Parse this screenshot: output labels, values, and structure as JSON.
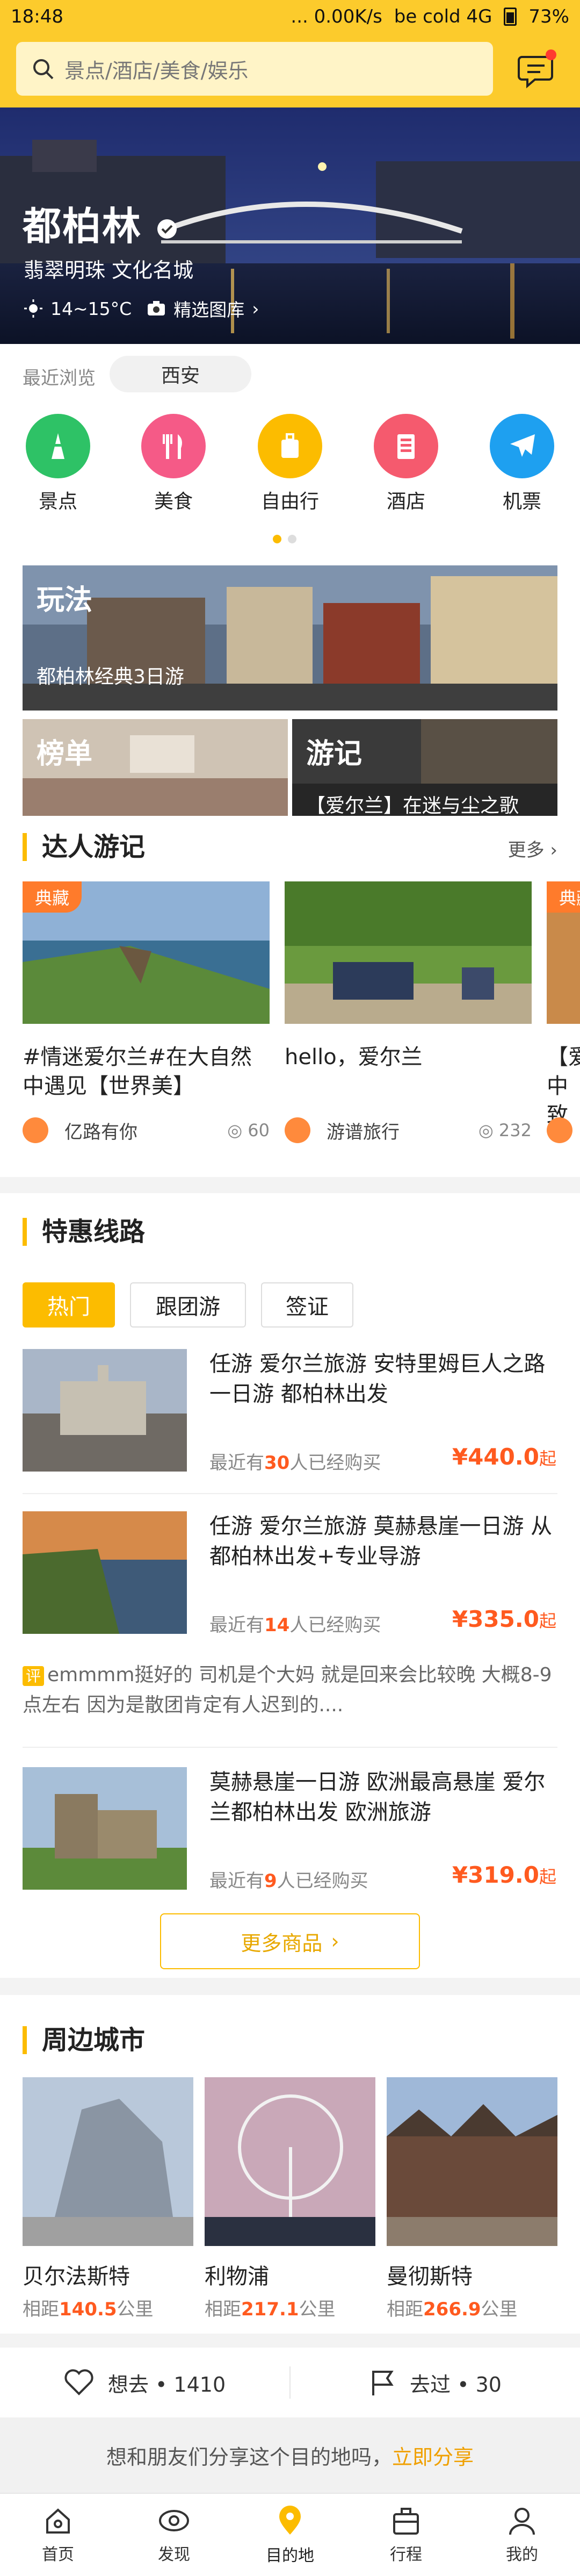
{
  "status": {
    "time": "18:48",
    "speed": "... 0.00K/s",
    "net": "be cold 4G",
    "battery": "73%"
  },
  "search": {
    "placeholder": "景点/酒店/美食/娱乐"
  },
  "hero": {
    "city": "都柏林",
    "tagline": "翡翠明珠 文化名城",
    "temp": "14~15°C",
    "gallery": "精选图库"
  },
  "recent": {
    "label": "最近浏览",
    "item": "西安"
  },
  "categories": [
    {
      "label": "景点",
      "color": "#2ec266",
      "icon": "tower-icon"
    },
    {
      "label": "美食",
      "color": "#f55a87",
      "icon": "fork-knife-icon"
    },
    {
      "label": "自由行",
      "color": "#fcbc00",
      "icon": "luggage-icon"
    },
    {
      "label": "酒店",
      "color": "#f55a6e",
      "icon": "hotel-icon"
    },
    {
      "label": "机票",
      "color": "#1ea0f0",
      "icon": "plane-icon"
    }
  ],
  "play": {
    "title": "玩法",
    "subtitle": "都柏林经典3日游",
    "rank": "榜单",
    "notes": "游记",
    "notes_sub": "【爱尔兰】在迷与尘之歌"
  },
  "travelogue": {
    "title": "达人游记",
    "more": "更多",
    "items": [
      {
        "badge": "典藏",
        "title": "#情迷爱尔兰#在大自然中遇见【世界美】",
        "user": "亿路有你",
        "views": "60"
      },
      {
        "badge": "",
        "title": "hello，爱尔兰",
        "user": "游谱旅行",
        "views": "232"
      },
      {
        "badge": "典藏",
        "title": "【爱中致",
        "user": "",
        "views": ""
      }
    ]
  },
  "deals": {
    "title": "特惠线路",
    "tabs": [
      "热门",
      "跟团游",
      "签证"
    ],
    "items": [
      {
        "title": "任游 爱尔兰旅游 安特里姆巨人之路一日游 都柏林出发",
        "sold_pre": "最近有",
        "sold_num": "30",
        "sold_post": "人已经购买",
        "price": "¥440.0",
        "unit": "起"
      },
      {
        "title": "任游 爱尔兰旅游 莫赫悬崖一日游 从都柏林出发+专业导游",
        "sold_pre": "最近有",
        "sold_num": "14",
        "sold_post": "人已经购买",
        "price": "¥335.0",
        "unit": "起"
      },
      {
        "title": "莫赫悬崖一日游 欧洲最高悬崖 爱尔兰都柏林出发 欧洲旅游",
        "sold_pre": "最近有",
        "sold_num": "9",
        "sold_post": "人已经购买",
        "price": "¥319.0",
        "unit": "起"
      }
    ],
    "review_tag": "评",
    "review": "emmmm挺好的 司机是个大妈 就是回来会比较晚 大概8-9点左右 因为是散团肯定有人迟到的....",
    "more_button": "更多商品"
  },
  "nearby": {
    "title": "周边城市",
    "items": [
      {
        "name": "贝尔法斯特",
        "prefix": "相距",
        "dist": "140.5",
        "unit": "公里"
      },
      {
        "name": "利物浦",
        "prefix": "相距",
        "dist": "217.1",
        "unit": "公里"
      },
      {
        "name": "曼彻斯特",
        "prefix": "相距",
        "dist": "266.9",
        "unit": "公里"
      }
    ]
  },
  "actions": {
    "want": "想去 • 1410",
    "been": "去过 • 30"
  },
  "share": {
    "text": "想和朋友们分享这个目的地吗，",
    "link": "立即分享"
  },
  "nav": [
    "首页",
    "发现",
    "目的地",
    "行程",
    "我的"
  ],
  "colors": {
    "accent": "#fcbc00",
    "price": "#ff5a1f"
  }
}
